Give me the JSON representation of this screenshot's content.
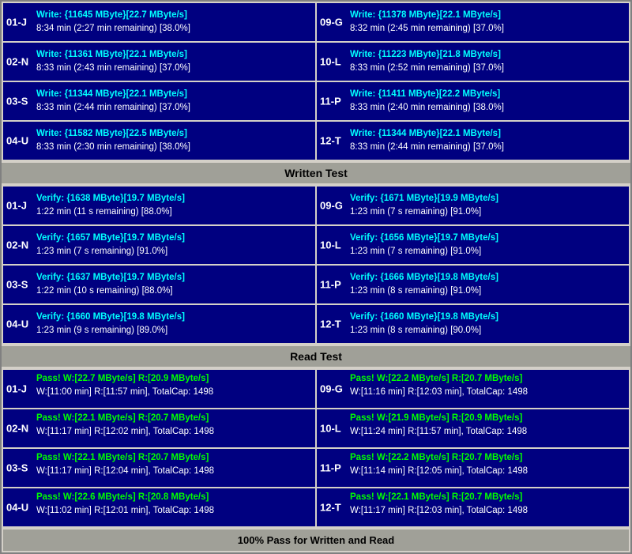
{
  "sections": {
    "write": {
      "label": "Written Test",
      "cards": [
        {
          "id": "01-J",
          "line1": "Write: {11645 MByte}[22.7 MByte/s]",
          "line2": "8:34 min (2:27 min remaining)  [38.0%]"
        },
        {
          "id": "09-G",
          "line1": "Write: {11378 MByte}[22.1 MByte/s]",
          "line2": "8:32 min (2:45 min remaining)  [37.0%]"
        },
        {
          "id": "02-N",
          "line1": "Write: {11361 MByte}[22.1 MByte/s]",
          "line2": "8:33 min (2:43 min remaining)  [37.0%]"
        },
        {
          "id": "10-L",
          "line1": "Write: {11223 MByte}[21.8 MByte/s]",
          "line2": "8:33 min (2:52 min remaining)  [37.0%]"
        },
        {
          "id": "03-S",
          "line1": "Write: {11344 MByte}[22.1 MByte/s]",
          "line2": "8:33 min (2:44 min remaining)  [37.0%]"
        },
        {
          "id": "11-P",
          "line1": "Write: {11411 MByte}[22.2 MByte/s]",
          "line2": "8:33 min (2:40 min remaining)  [38.0%]"
        },
        {
          "id": "04-U",
          "line1": "Write: {11582 MByte}[22.5 MByte/s]",
          "line2": "8:33 min (2:30 min remaining)  [38.0%]"
        },
        {
          "id": "12-T",
          "line1": "Write: {11344 MByte}[22.1 MByte/s]",
          "line2": "8:33 min (2:44 min remaining)  [37.0%]"
        }
      ]
    },
    "verify": {
      "label": "Written Test",
      "cards": [
        {
          "id": "01-J",
          "line1": "Verify: {1638 MByte}[19.7 MByte/s]",
          "line2": "1:22 min (11 s remaining)   [88.0%]"
        },
        {
          "id": "09-G",
          "line1": "Verify: {1671 MByte}[19.9 MByte/s]",
          "line2": "1:23 min (7 s remaining)   [91.0%]"
        },
        {
          "id": "02-N",
          "line1": "Verify: {1657 MByte}[19.7 MByte/s]",
          "line2": "1:23 min (7 s remaining)   [91.0%]"
        },
        {
          "id": "10-L",
          "line1": "Verify: {1656 MByte}[19.7 MByte/s]",
          "line2": "1:23 min (7 s remaining)   [91.0%]"
        },
        {
          "id": "03-S",
          "line1": "Verify: {1637 MByte}[19.7 MByte/s]",
          "line2": "1:22 min (10 s remaining)   [88.0%]"
        },
        {
          "id": "11-P",
          "line1": "Verify: {1666 MByte}[19.8 MByte/s]",
          "line2": "1:23 min (8 s remaining)   [91.0%]"
        },
        {
          "id": "04-U",
          "line1": "Verify: {1660 MByte}[19.8 MByte/s]",
          "line2": "1:23 min (9 s remaining)   [89.0%]"
        },
        {
          "id": "12-T",
          "line1": "Verify: {1660 MByte}[19.8 MByte/s]",
          "line2": "1:23 min (8 s remaining)   [90.0%]"
        }
      ]
    },
    "read": {
      "label": "Read Test",
      "cards": [
        {
          "id": "01-J",
          "line1": "Pass! W:[22.7 MByte/s] R:[20.9 MByte/s]",
          "line2": "W:[11:00 min] R:[11:57 min], TotalCap: 1498"
        },
        {
          "id": "09-G",
          "line1": "Pass! W:[22.2 MByte/s] R:[20.7 MByte/s]",
          "line2": "W:[11:16 min] R:[12:03 min], TotalCap: 1498"
        },
        {
          "id": "02-N",
          "line1": "Pass! W:[22.1 MByte/s] R:[20.7 MByte/s]",
          "line2": "W:[11:17 min] R:[12:02 min], TotalCap: 1498"
        },
        {
          "id": "10-L",
          "line1": "Pass! W:[21.9 MByte/s] R:[20.9 MByte/s]",
          "line2": "W:[11:24 min] R:[11:57 min], TotalCap: 1498"
        },
        {
          "id": "03-S",
          "line1": "Pass! W:[22.1 MByte/s] R:[20.7 MByte/s]",
          "line2": "W:[11:17 min] R:[12:04 min], TotalCap: 1498"
        },
        {
          "id": "11-P",
          "line1": "Pass! W:[22.2 MByte/s] R:[20.7 MByte/s]",
          "line2": "W:[11:14 min] R:[12:05 min], TotalCap: 1498"
        },
        {
          "id": "04-U",
          "line1": "Pass! W:[22.6 MByte/s] R:[20.8 MByte/s]",
          "line2": "W:[11:02 min] R:[12:01 min], TotalCap: 1498"
        },
        {
          "id": "12-T",
          "line1": "Pass! W:[22.1 MByte/s] R:[20.7 MByte/s]",
          "line2": "W:[11:17 min] R:[12:03 min], TotalCap: 1498"
        }
      ]
    }
  },
  "labels": {
    "written_test": "Written Test",
    "read_test": "Read Test",
    "footer": "100% Pass for Written and Read"
  }
}
